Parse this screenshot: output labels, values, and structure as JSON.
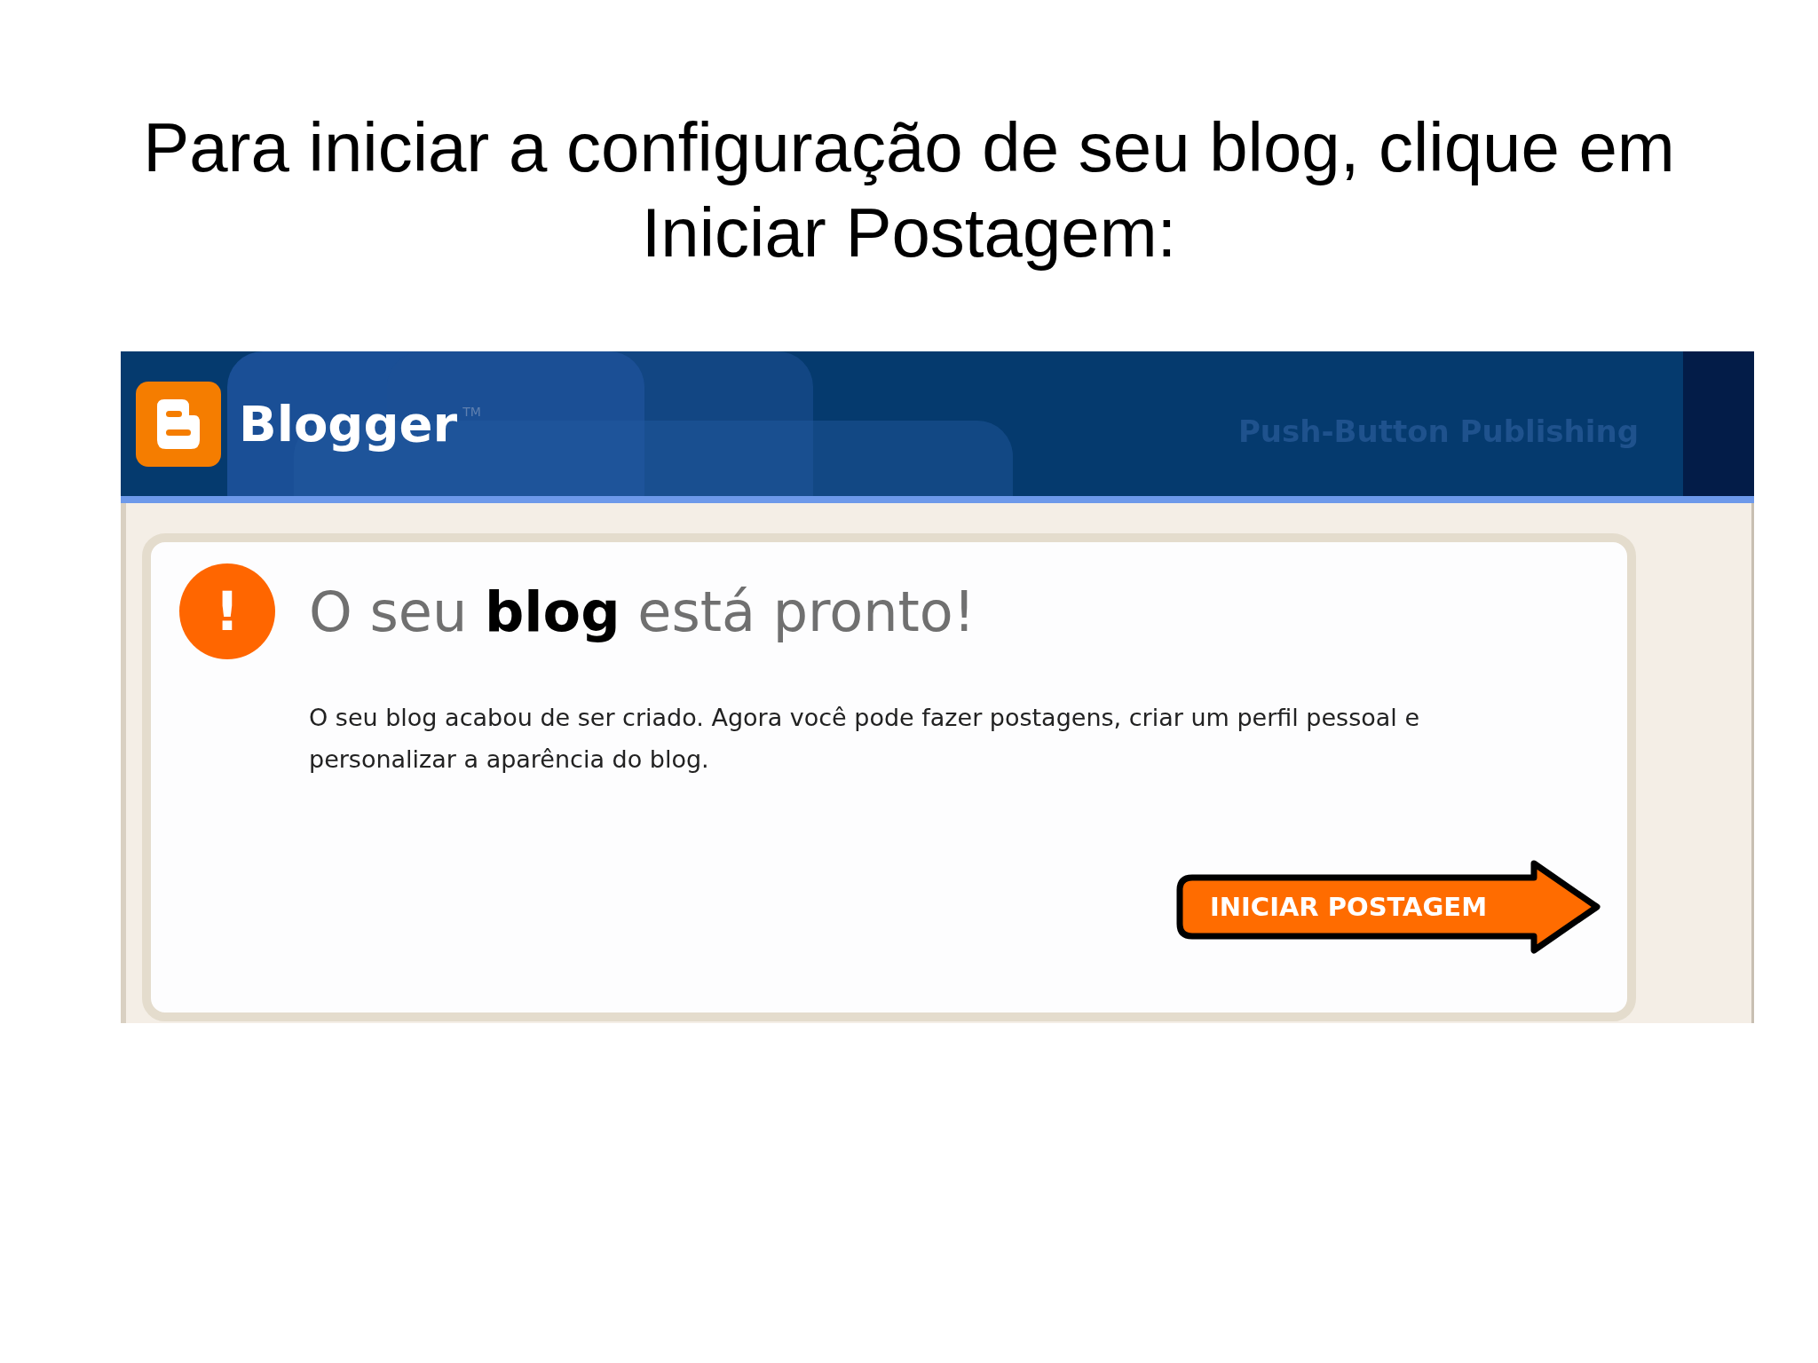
{
  "slide_title": "Para iniciar a configuração de seu blog, clique em Iniciar Postagem:",
  "screenshot": {
    "header": {
      "logo_text": "Blogger",
      "trademark": "TM",
      "tagline": "Push-Button Publishing"
    },
    "card": {
      "alert_mark": "!",
      "heading": "O seu **blog** está pronto!",
      "message": "O seu blog acabou de ser criado. Agora você pode fazer postagens, criar um perfil pessoal e personalizar a aparência do blog.",
      "button": "INICIAR POSTAGEM"
    }
  }
}
